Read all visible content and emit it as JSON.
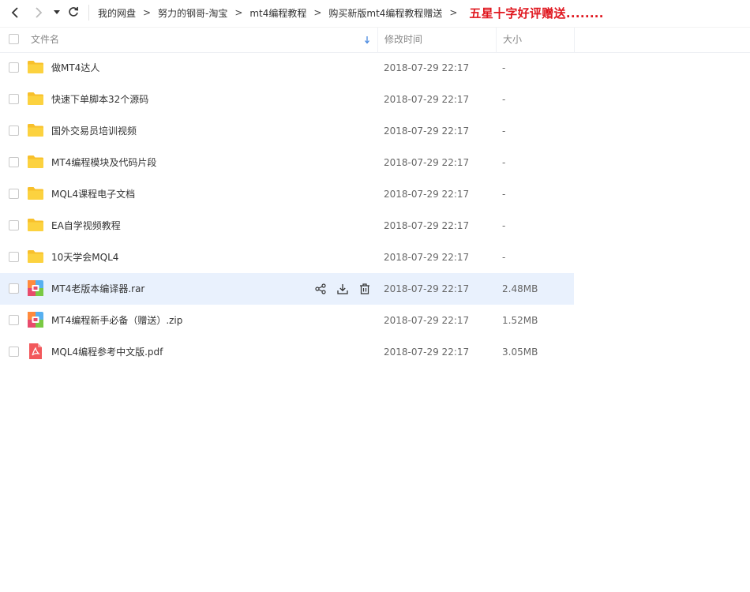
{
  "nav": {
    "back_icon": "chevron-left-icon",
    "forward_icon": "chevron-right-icon",
    "history_icon": "caret-down-icon",
    "refresh_icon": "refresh-icon"
  },
  "breadcrumb": {
    "items": [
      "我的网盘",
      "努力的钢哥-淘宝",
      "mt4编程教程",
      "购买新版mt4编程教程赠送"
    ],
    "separator": ">",
    "promo": "五星十字好评赠送........",
    "promo_color": "#e0171f"
  },
  "table": {
    "columns": {
      "name": "文件名",
      "modified": "修改时间",
      "size": "大小"
    },
    "sort_icon": "sort-arrow-down-icon",
    "rows": [
      {
        "type": "folder",
        "name": "做MT4达人",
        "modified": "2018-07-29 22:17",
        "size": "-"
      },
      {
        "type": "folder",
        "name": "快速下单脚本32个源码",
        "modified": "2018-07-29 22:17",
        "size": "-"
      },
      {
        "type": "folder",
        "name": "国外交易员培训视频",
        "modified": "2018-07-29 22:17",
        "size": "-"
      },
      {
        "type": "folder",
        "name": "MT4编程模块及代码片段",
        "modified": "2018-07-29 22:17",
        "size": "-"
      },
      {
        "type": "folder",
        "name": "MQL4课程电子文档",
        "modified": "2018-07-29 22:17",
        "size": "-"
      },
      {
        "type": "folder",
        "name": "EA自学视频教程",
        "modified": "2018-07-29 22:17",
        "size": "-"
      },
      {
        "type": "folder",
        "name": "10天学会MQL4",
        "modified": "2018-07-29 22:17",
        "size": "-"
      },
      {
        "type": "archive",
        "name": "MT4老版本编译器.rar",
        "modified": "2018-07-29 22:17",
        "size": "2.48MB",
        "hovered": true
      },
      {
        "type": "archive",
        "name": "MT4编程新手必备（赠送）.zip",
        "modified": "2018-07-29 22:17",
        "size": "1.52MB"
      },
      {
        "type": "pdf",
        "name": "MQL4编程参考中文版.pdf",
        "modified": "2018-07-29 22:17",
        "size": "3.05MB"
      }
    ],
    "row_actions": [
      "share-icon",
      "download-icon",
      "delete-icon"
    ]
  },
  "colors": {
    "folder": "#f8c02b",
    "hover_row": "#e9f1fd",
    "pdf": "#f2585b",
    "sort_arrow": "#4a8ae0"
  }
}
